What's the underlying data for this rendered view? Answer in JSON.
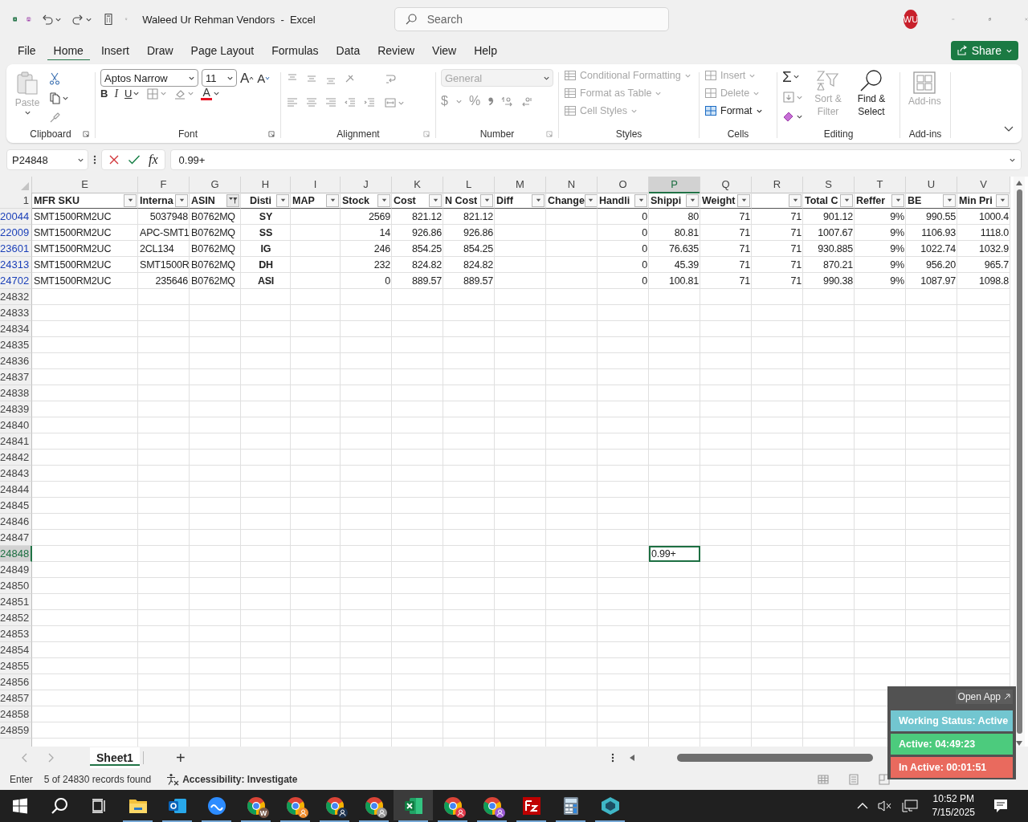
{
  "window": {
    "title": "Waleed Ur Rehman Vendors  -  Excel",
    "search_placeholder": "Search",
    "user_initials": "WU"
  },
  "menu_tabs": [
    {
      "label": "File",
      "selected": false
    },
    {
      "label": "Home",
      "selected": true
    },
    {
      "label": "Insert",
      "selected": false
    },
    {
      "label": "Draw",
      "selected": false
    },
    {
      "label": "Page Layout",
      "selected": false
    },
    {
      "label": "Formulas",
      "selected": false
    },
    {
      "label": "Data",
      "selected": false
    },
    {
      "label": "Review",
      "selected": false
    },
    {
      "label": "View",
      "selected": false
    },
    {
      "label": "Help",
      "selected": false
    }
  ],
  "share_button": "Share",
  "ribbon": {
    "clipboard": {
      "label": "Clipboard",
      "paste": {
        "label": "Paste",
        "disabled": true
      }
    },
    "font": {
      "label": "Font",
      "font_name": "Aptos Narrow",
      "font_size": "11",
      "grow": "A",
      "shrink": "A",
      "bold": "B",
      "italic": "I",
      "underline": "U",
      "font_color": "A"
    },
    "alignment": {
      "label": "Alignment"
    },
    "number": {
      "label": "Number",
      "format": {
        "value": "General",
        "disabled": true
      },
      "currency": "$",
      "percent": "%"
    },
    "styles": {
      "label": "Styles",
      "items": [
        {
          "label": "Conditional Formatting",
          "disabled": true
        },
        {
          "label": "Format as Table",
          "disabled": true
        },
        {
          "label": "Cell Styles",
          "disabled": true
        }
      ]
    },
    "cells": {
      "label": "Cells",
      "items": [
        {
          "label": "Insert",
          "disabled": true
        },
        {
          "label": "Delete",
          "disabled": true
        },
        {
          "label": "Format",
          "disabled": false
        }
      ]
    },
    "editing": {
      "label": "Editing",
      "autosum": "Σ",
      "sort_filter": {
        "label": "Sort & Filter",
        "disabled": true
      },
      "find_select": {
        "label": "Find & Select",
        "disabled": false
      }
    },
    "addins": {
      "label": "Add-ins",
      "button": {
        "label": "Add-ins",
        "disabled": true
      }
    }
  },
  "sheet": {
    "name_box": "P24848",
    "fx": "fx",
    "formula": "0.99+",
    "header_row": "1",
    "columns": [
      {
        "letter": "E",
        "heading": "MFR SKU",
        "kind": "text",
        "filtered": false,
        "selected": false
      },
      {
        "letter": "F",
        "heading": "Interna",
        "kind": "number",
        "filtered": false,
        "selected": false
      },
      {
        "letter": "G",
        "heading": "ASIN",
        "kind": "text",
        "filtered": true,
        "selected": false
      },
      {
        "letter": "H",
        "heading": "Disti",
        "kind": "code",
        "filtered": false,
        "selected": false
      },
      {
        "letter": "I",
        "heading": "MAP",
        "kind": "text",
        "filtered": false,
        "selected": false
      },
      {
        "letter": "J",
        "heading": "Stock",
        "kind": "number",
        "filtered": false,
        "selected": false
      },
      {
        "letter": "K",
        "heading": "Cost",
        "kind": "number",
        "filtered": false,
        "selected": false
      },
      {
        "letter": "L",
        "heading": "N Cost",
        "kind": "number",
        "filtered": false,
        "selected": false
      },
      {
        "letter": "M",
        "heading": "Diff",
        "kind": "number",
        "filtered": false,
        "selected": false
      },
      {
        "letter": "N",
        "heading": "Change",
        "kind": "number",
        "filtered": false,
        "selected": false
      },
      {
        "letter": "O",
        "heading": "Handli",
        "kind": "number",
        "filtered": false,
        "selected": false
      },
      {
        "letter": "P",
        "heading": "Shippi",
        "kind": "number",
        "filtered": false,
        "selected": true
      },
      {
        "letter": "Q",
        "heading": "Weight",
        "kind": "number",
        "filtered": false,
        "selected": false
      },
      {
        "letter": "R",
        "kind": "number",
        "filtered": false,
        "selected": false
      },
      {
        "letter": "S",
        "heading": "Total C",
        "kind": "number",
        "filtered": false,
        "selected": false
      },
      {
        "letter": "T",
        "heading": "Reffer",
        "kind": "number",
        "filtered": false,
        "selected": false
      },
      {
        "letter": "U",
        "heading": "BE",
        "kind": "number",
        "filtered": false,
        "selected": false
      },
      {
        "letter": "V",
        "heading": "Min Pri",
        "kind": "number",
        "filtered": false,
        "selected": false
      }
    ],
    "rows": [
      {
        "number": "20044",
        "match": true,
        "selected": false,
        "cells": {
          "E": "SMT1500RM2UC",
          "F": "5037948",
          "G": "B0762MQ",
          "H": "SY",
          "J": "2569",
          "K": "821.12",
          "L": "821.12",
          "O": "0",
          "P": "80",
          "Q": "71",
          "R": "71",
          "S": "901.12",
          "T": "9%",
          "U": "990.55",
          "V": "1000.4"
        }
      },
      {
        "number": "22009",
        "match": true,
        "selected": false,
        "cells": {
          "E": "SMT1500RM2UC",
          "F": {
            "text": "APC-SMT1",
            "kind": "text"
          },
          "G": "B0762MQ",
          "H": "SS",
          "J": "14",
          "K": "926.86",
          "L": "926.86",
          "O": "0",
          "P": "80.81",
          "Q": "71",
          "R": "71",
          "S": "1007.67",
          "T": "9%",
          "U": "1106.93",
          "V": "1118.0"
        }
      },
      {
        "number": "23601",
        "match": true,
        "selected": false,
        "cells": {
          "E": "SMT1500RM2UC",
          "F": {
            "text": "2CL134",
            "kind": "text"
          },
          "G": "B0762MQ",
          "H": "IG",
          "J": "246",
          "K": "854.25",
          "L": "854.25",
          "O": "0",
          "P": "76.635",
          "Q": "71",
          "R": "71",
          "S": "930.885",
          "T": "9%",
          "U": "1022.74",
          "V": "1032.9"
        }
      },
      {
        "number": "24313",
        "match": true,
        "selected": false,
        "cells": {
          "E": "SMT1500RM2UC",
          "F": {
            "text": "SMT1500R",
            "kind": "text"
          },
          "G": "B0762MQ",
          "H": "DH",
          "J": "232",
          "K": "824.82",
          "L": "824.82",
          "O": "0",
          "P": "45.39",
          "Q": "71",
          "R": "71",
          "S": "870.21",
          "T": "9%",
          "U": "956.20",
          "V": "965.7"
        }
      },
      {
        "number": "24702",
        "match": true,
        "selected": false,
        "cells": {
          "E": "SMT1500RM2UC",
          "F": "235646",
          "G": "B0762MQ",
          "H": "ASI",
          "J": "0",
          "K": "889.57",
          "L": "889.57",
          "O": "0",
          "P": "100.81",
          "Q": "71",
          "R": "71",
          "S": "990.38",
          "T": "9%",
          "U": "1087.97",
          "V": "1098.8"
        }
      },
      {
        "number": "24832",
        "match": false,
        "selected": false
      },
      {
        "number": "24833",
        "match": false,
        "selected": false
      },
      {
        "number": "24834",
        "match": false,
        "selected": false
      },
      {
        "number": "24835",
        "match": false,
        "selected": false
      },
      {
        "number": "24836",
        "match": false,
        "selected": false
      },
      {
        "number": "24837",
        "match": false,
        "selected": false
      },
      {
        "number": "24838",
        "match": false,
        "selected": false
      },
      {
        "number": "24839",
        "match": false,
        "selected": false
      },
      {
        "number": "24840",
        "match": false,
        "selected": false
      },
      {
        "number": "24841",
        "match": false,
        "selected": false
      },
      {
        "number": "24842",
        "match": false,
        "selected": false
      },
      {
        "number": "24843",
        "match": false,
        "selected": false
      },
      {
        "number": "24844",
        "match": false,
        "selected": false
      },
      {
        "number": "24845",
        "match": false,
        "selected": false
      },
      {
        "number": "24846",
        "match": false,
        "selected": false
      },
      {
        "number": "24847",
        "match": false,
        "selected": false
      },
      {
        "number": "24848",
        "match": false,
        "selected": true,
        "cells": {
          "P": {
            "text": "0.99+",
            "kind": "text"
          }
        }
      },
      {
        "number": "24849",
        "match": false,
        "selected": false
      },
      {
        "number": "24850",
        "match": false,
        "selected": false
      },
      {
        "number": "24851",
        "match": false,
        "selected": false
      },
      {
        "number": "24852",
        "match": false,
        "selected": false
      },
      {
        "number": "24853",
        "match": false,
        "selected": false
      },
      {
        "number": "24854",
        "match": false,
        "selected": false
      },
      {
        "number": "24855",
        "match": false,
        "selected": false
      },
      {
        "number": "24856",
        "match": false,
        "selected": false
      },
      {
        "number": "24857",
        "match": false,
        "selected": false
      },
      {
        "number": "24858",
        "match": false,
        "selected": false
      },
      {
        "number": "24859",
        "match": false,
        "selected": false
      }
    ],
    "tabs": [
      {
        "label": "Sheet1",
        "selected": true
      }
    ],
    "add_sheet": "+"
  },
  "status_bar": {
    "mode": "Enter",
    "records": "5 of 24830 records found",
    "accessibility": "Accessibility: Investigate"
  },
  "tracker": {
    "open_app": "Open App",
    "statuses": [
      {
        "label": "Working Status: Active",
        "color": "#72c6d0"
      },
      {
        "label": "Active: 04:49:23",
        "color": "#4ccb7d"
      },
      {
        "label": "In Active: 00:01:51",
        "color": "#e96a5e"
      }
    ]
  },
  "taskbar": {
    "apps": [
      {
        "kind": "start",
        "selected": false
      },
      {
        "kind": "search",
        "selected": false
      },
      {
        "kind": "task_view",
        "selected": false
      },
      {
        "kind": "files",
        "selected": false
      },
      {
        "kind": "outlook",
        "selected": false
      },
      {
        "kind": "zoom",
        "selected": false
      },
      {
        "kind": "chrome",
        "selected": false,
        "color": "#7a5a4b",
        "badge_text": "W"
      },
      {
        "kind": "chrome",
        "selected": false,
        "color": "#f08c2c"
      },
      {
        "kind": "chrome",
        "selected": false,
        "color": "#1e3350"
      },
      {
        "kind": "chrome",
        "selected": false,
        "color": "#9a9a9a"
      },
      {
        "kind": "excel",
        "selected": true
      },
      {
        "kind": "chrome",
        "selected": false,
        "color": "#e23b4c"
      },
      {
        "kind": "chrome",
        "selected": false,
        "color": "#9b5bd6"
      },
      {
        "kind": "filezilla",
        "selected": false
      },
      {
        "kind": "calculator",
        "selected": false
      },
      {
        "kind": "cube",
        "selected": false
      }
    ],
    "time": "10:52 PM",
    "date": "7/15/2025"
  }
}
